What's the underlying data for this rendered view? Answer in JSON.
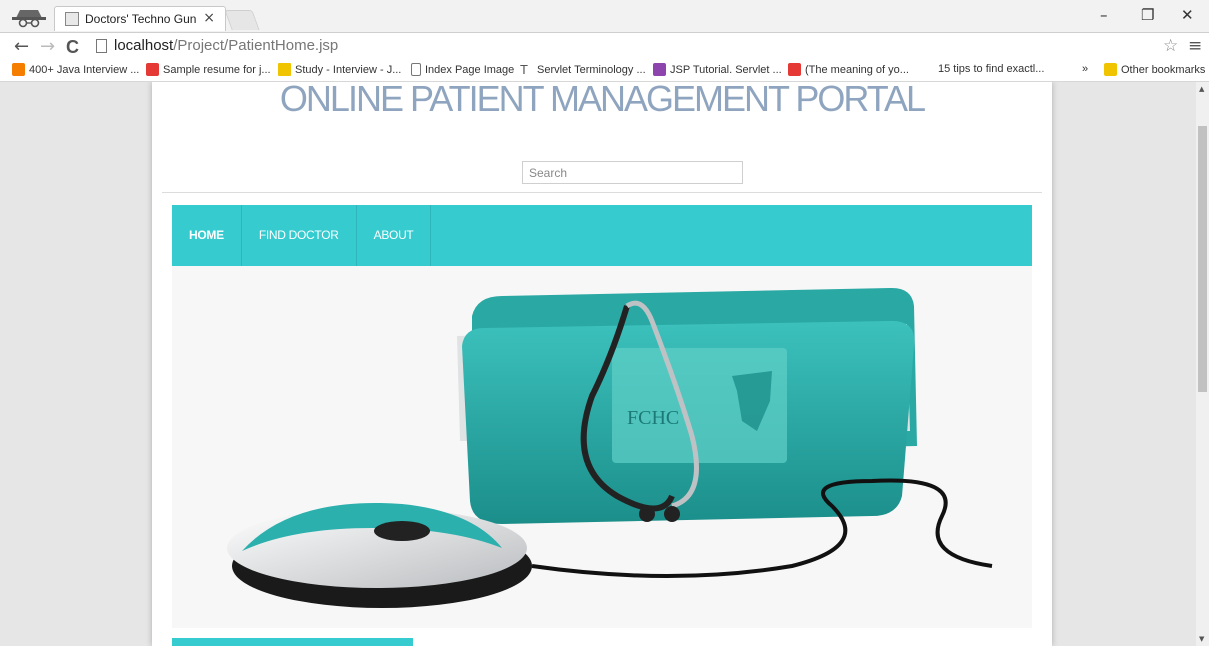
{
  "browser": {
    "tab_title": "Doctors' Techno Gun",
    "tab_close": "×",
    "url_host": "localhost",
    "url_path": "/Project/PatientHome.jsp",
    "window_controls": {
      "minimize": "–",
      "restore": "❐",
      "close": "✕"
    },
    "nav": {
      "back": "←",
      "forward": "→",
      "reload": "C"
    },
    "star": "☆",
    "menu": "≡",
    "bookmarks": [
      {
        "label": "400+ Java Interview ...",
        "icon": "blogger-icon",
        "color": "#f57d00"
      },
      {
        "label": "Sample resume for j...",
        "icon": "red-c-icon",
        "color": "#e53935"
      },
      {
        "label": "Study - Interview - J...",
        "icon": "folder-icon",
        "color": "#f0c400"
      },
      {
        "label": "Index Page Image",
        "icon": "page-icon",
        "color": "#ffffff"
      },
      {
        "label": "Servlet Terminology ...",
        "icon": "typography-icon",
        "color": "#555555"
      },
      {
        "label": "JSP Tutorial. Servlet ...",
        "icon": "jsp-icon",
        "color": "#8e44ad"
      },
      {
        "label": "(The meaning of yo...",
        "icon": "red-badge-icon",
        "color": "#e53935"
      },
      {
        "label": "15 tips to find exactl...",
        "icon": "none",
        "color": "#ffffff"
      }
    ],
    "bookmarks_overflow": "»",
    "other_bookmarks": "Other bookmarks"
  },
  "site": {
    "title": "ONLINE PATIENT MANAGEMENT PORTAL",
    "search_placeholder": "Search",
    "nav": [
      {
        "label": "HOME",
        "active": true
      },
      {
        "label": "FIND DOCTOR",
        "active": false
      },
      {
        "label": "ABOUT",
        "active": false
      }
    ],
    "hero_emblem": "FCHC",
    "accent_color": "#35cbcf",
    "title_color": "#8fa5bf"
  }
}
